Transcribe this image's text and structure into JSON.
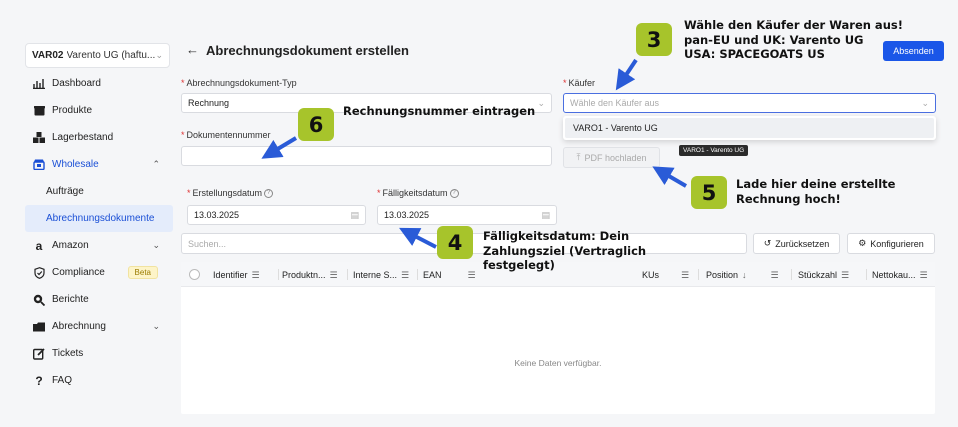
{
  "workspace": {
    "code": "VAR02",
    "name": "Varento UG (haftu..."
  },
  "sidebar": {
    "items": [
      {
        "label": "Dashboard",
        "icon": "chart-icon"
      },
      {
        "label": "Produkte",
        "icon": "box-icon"
      },
      {
        "label": "Lagerbestand",
        "icon": "stock-icon"
      },
      {
        "label": "Wholesale",
        "icon": "store-icon"
      },
      {
        "label": "Aufträge"
      },
      {
        "label": "Abrechnungsdokumente"
      },
      {
        "label": "Amazon",
        "icon": "amazon-icon"
      },
      {
        "label": "Compliance",
        "icon": "shield-icon",
        "badge": "Beta"
      },
      {
        "label": "Berichte",
        "icon": "search-report-icon"
      },
      {
        "label": "Abrechnung",
        "icon": "wallet-icon"
      },
      {
        "label": "Tickets",
        "icon": "edit-icon"
      },
      {
        "label": "FAQ",
        "icon": "question-icon"
      }
    ]
  },
  "header": {
    "back": "←",
    "title": "Abrechnungsdokument erstellen",
    "send": "Absenden"
  },
  "form": {
    "doctype_label": "Abrechnungsdokument-Typ",
    "doctype_value": "Rechnung",
    "buyer_label": "Käufer",
    "buyer_placeholder": "Wähle den Käufer aus",
    "buyer_option": "VARO1 - Varento UG",
    "docnum_label": "Dokumentennummer",
    "upload": "PDF hochladen",
    "tooltip": "VARO1 - Varento UG",
    "created_label": "Erstellungsdatum",
    "created_value": "13.03.2025",
    "due_label": "Fälligkeitsdatum",
    "due_value": "13.03.2025",
    "required": "*",
    "help": "?"
  },
  "toolbar": {
    "search_placeholder": "Suchen...",
    "reset": "Zurücksetzen",
    "configure": "Konfigurieren"
  },
  "table": {
    "columns": [
      "Identifier",
      "Produktn...",
      "Interne S...",
      "EAN",
      "KUs",
      "Position",
      "Stückzahl",
      "Nettokau..."
    ],
    "empty": "Keine Daten verfügbar."
  },
  "annotations": {
    "a3": {
      "num": "3",
      "line1": "Wähle den Käufer der Waren aus!",
      "line2": "pan-EU und UK: Varento UG",
      "line3": "USA: SPACEGOATS US"
    },
    "a6": {
      "num": "6",
      "text": "Rechnungsnummer eintragen"
    },
    "a5": {
      "num": "5",
      "line1": "Lade hier deine erstellte",
      "line2": "Rechnung hoch!"
    },
    "a4": {
      "num": "4",
      "line1": "Fälligkeitsdatum: Dein",
      "line2": "Zahlungsziel (Vertraglich",
      "line3": "festgelegt)"
    }
  },
  "colors": {
    "accent": "#1a56e8",
    "badge": "#a7c42b",
    "arrow": "#2a5bd7"
  }
}
